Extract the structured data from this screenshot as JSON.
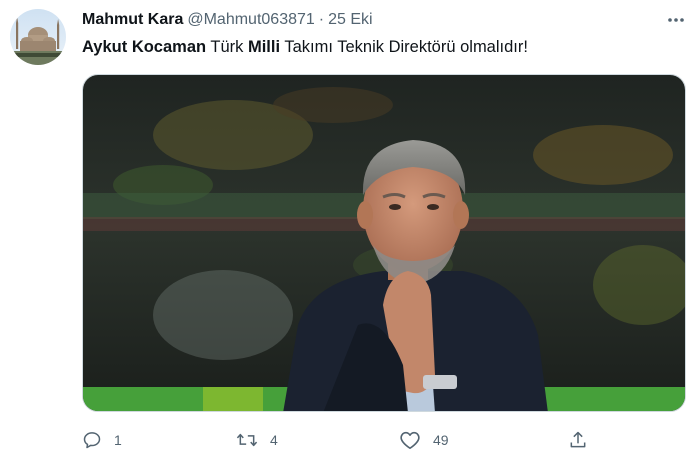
{
  "tweet": {
    "display_name": "Mahmut Kara",
    "handle": "@Mahmut063871",
    "separator": "·",
    "date": "25 Eki",
    "text_parts": [
      {
        "text": "Aykut Kocaman",
        "bold": true
      },
      {
        "text": " Türk ",
        "bold": false
      },
      {
        "text": "Milli",
        "bold": true
      },
      {
        "text": " Takımı Teknik Direktörü olmalıdır!",
        "bold": false
      }
    ],
    "actions": {
      "reply_count": "1",
      "retweet_count": "4",
      "like_count": "49"
    }
  },
  "icons": {
    "more": "more-dots-icon",
    "reply": "reply-icon",
    "retweet": "retweet-icon",
    "like": "heart-icon",
    "share": "share-icon"
  },
  "colors": {
    "text_primary": "#0f1419",
    "text_secondary": "#536471",
    "border": "#cfd9de"
  }
}
